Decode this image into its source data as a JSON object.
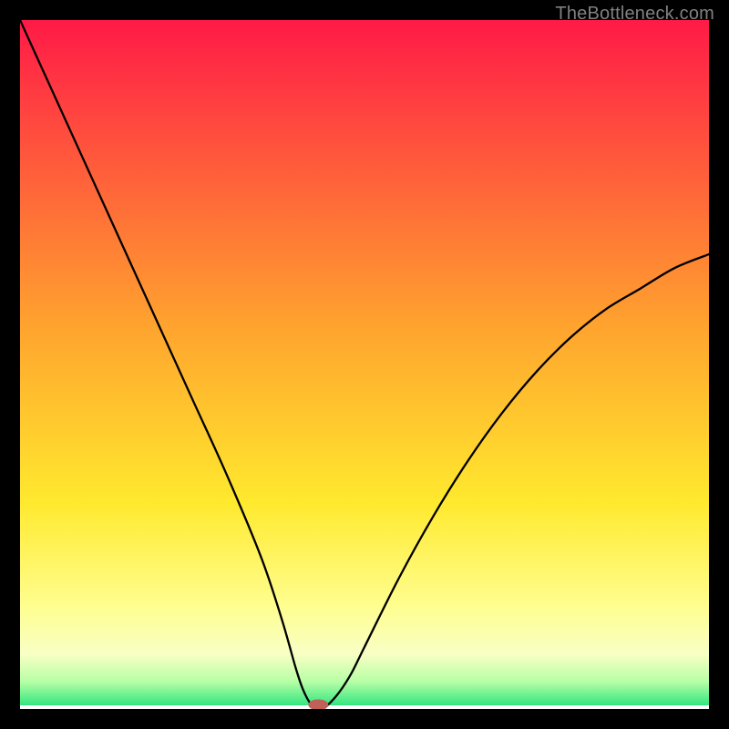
{
  "watermark": "TheBottleneck.com",
  "chart_data": {
    "type": "line",
    "title": "",
    "xlabel": "",
    "ylabel": "",
    "xlim": [
      0,
      100
    ],
    "ylim": [
      0,
      100
    ],
    "grid": false,
    "legend": false,
    "background_gradient_stops": [
      {
        "offset": 0.0,
        "color": "#ff1a47"
      },
      {
        "offset": 0.45,
        "color": "#ffa52e"
      },
      {
        "offset": 0.7,
        "color": "#ffe92e"
      },
      {
        "offset": 0.85,
        "color": "#fffe8f"
      },
      {
        "offset": 0.92,
        "color": "#f8ffc4"
      },
      {
        "offset": 0.96,
        "color": "#b8ffa6"
      },
      {
        "offset": 1.0,
        "color": "#1fe27a"
      }
    ],
    "series": [
      {
        "name": "bottleneck-curve",
        "x": [
          0,
          5,
          10,
          15,
          20,
          25,
          30,
          35,
          38,
          40,
          41,
          42,
          43,
          43.5,
          44,
          46,
          48,
          50,
          55,
          60,
          65,
          70,
          75,
          80,
          85,
          90,
          95,
          100
        ],
        "y": [
          100,
          89,
          78,
          67,
          56,
          45,
          34,
          22,
          13,
          6,
          3,
          1,
          0,
          0,
          0,
          2,
          5,
          9,
          19,
          28,
          36,
          43,
          49,
          54,
          58,
          61,
          64,
          66
        ]
      }
    ],
    "marker": {
      "x": 43.3,
      "y": 0.6,
      "rx": 11,
      "ry": 6,
      "fill": "#c06058"
    },
    "bottom_band_color": "#ffffff"
  }
}
